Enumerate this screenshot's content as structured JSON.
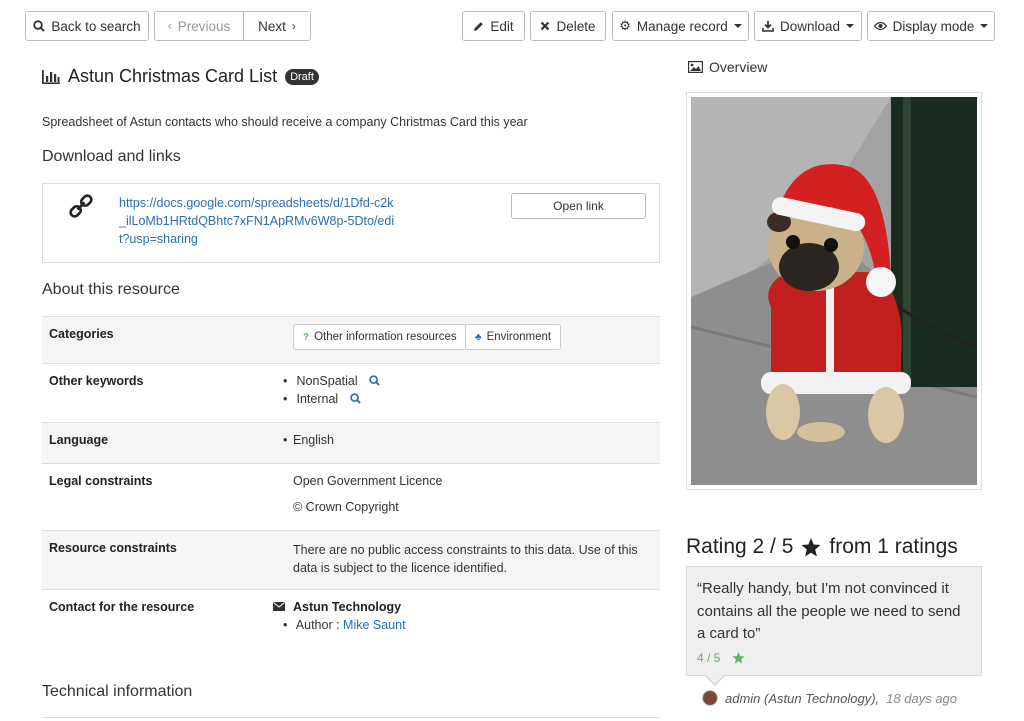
{
  "toolbar": {
    "back_label": "Back to search",
    "previous_label": "Previous",
    "next_label": "Next",
    "edit_label": "Edit",
    "delete_label": "Delete",
    "manage_label": "Manage record",
    "download_label": "Download",
    "display_label": "Display mode"
  },
  "record": {
    "title": "Astun Christmas Card List",
    "status_badge": "Draft",
    "abstract": "Spreadsheet of Astun contacts who should receive a company Christmas Card this year"
  },
  "sections": {
    "download_links": "Download and links",
    "about": "About this resource",
    "technical": "Technical information"
  },
  "link": {
    "url": "https://docs.google.com/spreadsheets/d/1Dfd-c2k_ilLoMb1HRtdQBhtc7xFN1ApRMv6W8p-5Dto/edit?usp=sharing",
    "open_label": "Open link"
  },
  "about": {
    "categories_label": "Categories",
    "categories": [
      "Other information resources",
      "Environment"
    ],
    "keywords_label": "Other keywords",
    "keywords": [
      "NonSpatial",
      "Internal"
    ],
    "language_label": "Language",
    "language": "English",
    "legal_label": "Legal constraints",
    "legal_1": "Open Government Licence",
    "legal_2": "© Crown Copyright",
    "resource_label": "Resource constraints",
    "resource_text": "There are no public access constraints to this data. Use of this data is subject to the licence identified.",
    "contact_label": "Contact for the resource",
    "contact_org": "Astun Technology",
    "contact_role": "Author : ",
    "contact_name": "Mike Saunt"
  },
  "overview": {
    "label": "Overview"
  },
  "rating": {
    "label": "Rating 2 / 5",
    "suffix": "from 1 ratings",
    "value": 2,
    "max": 5
  },
  "review": {
    "quote": "“Really handy, but I'm not convinced it contains all the people we need to send a card to”",
    "score": "4 / 5",
    "author": "admin (Astun Technology),",
    "date": "18 days ago"
  },
  "colors": {
    "link": "#2a6fb5",
    "badge": "#333333",
    "review_score": "#5cb85c",
    "environment_icon": "#2a6fb5",
    "other_icon": "#5cb85c"
  }
}
